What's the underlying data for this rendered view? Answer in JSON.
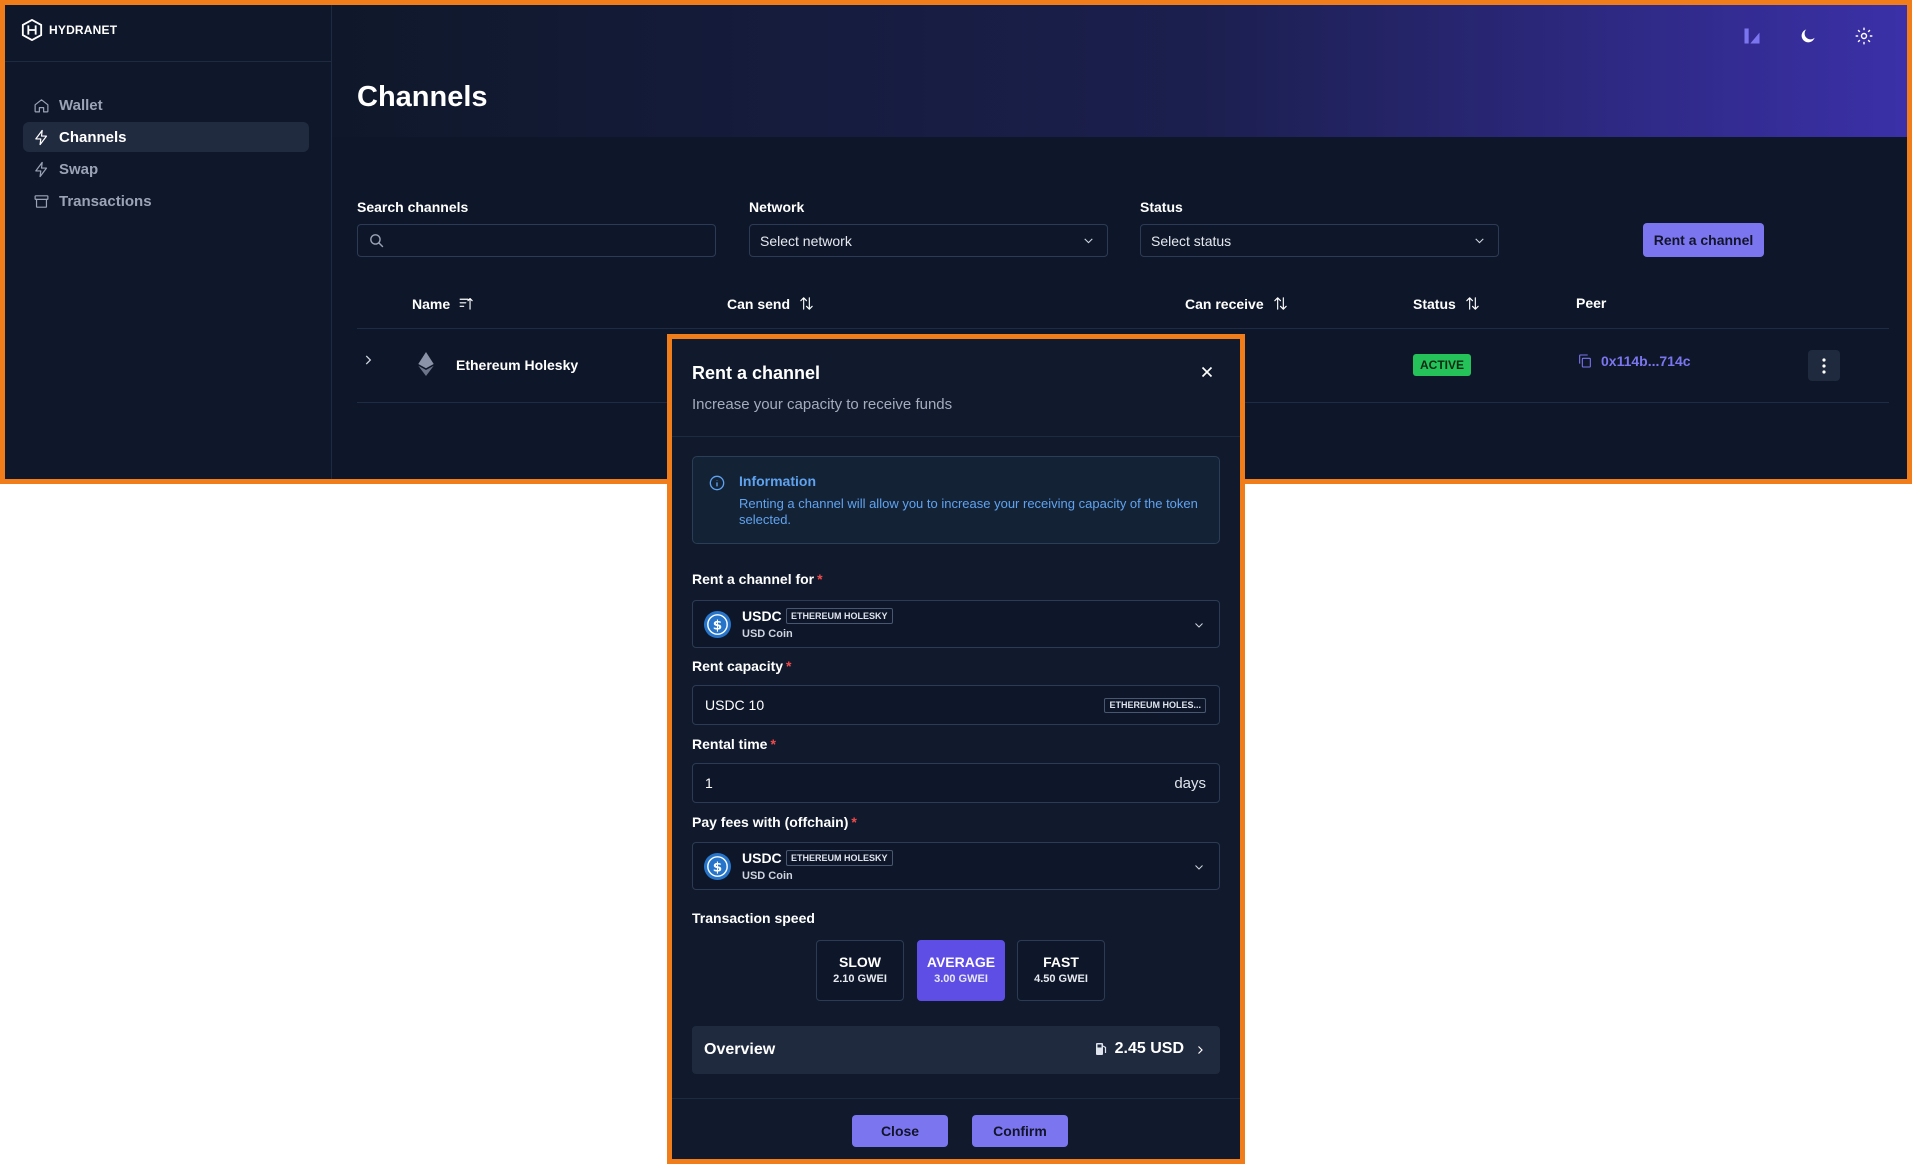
{
  "app": {
    "logo_text": "HYDRANET"
  },
  "sidebar": {
    "items": [
      {
        "label": "Wallet",
        "icon": "home-icon",
        "active": false
      },
      {
        "label": "Channels",
        "icon": "lightning-icon",
        "active": true
      },
      {
        "label": "Swap",
        "icon": "lightning-icon",
        "active": false
      },
      {
        "label": "Transactions",
        "icon": "archive-icon",
        "active": false
      }
    ]
  },
  "header": {
    "title": "Channels",
    "icons": [
      "chart-icon",
      "moon-icon",
      "gear-icon"
    ]
  },
  "filters": {
    "search": {
      "label": "Search channels",
      "placeholder": ""
    },
    "network": {
      "label": "Network",
      "value": "Select network"
    },
    "status": {
      "label": "Status",
      "value": "Select status"
    },
    "rent_button": "Rent a channel"
  },
  "table": {
    "columns": [
      "Name",
      "Can send",
      "Can receive",
      "Status",
      "Peer"
    ],
    "rows": [
      {
        "name": "Ethereum Holesky",
        "status": "ACTIVE",
        "peer": "0x114b...714c"
      }
    ]
  },
  "modal": {
    "title": "Rent a channel",
    "subtitle": "Increase your capacity to receive funds",
    "info": {
      "title": "Information",
      "text": "Renting a channel will allow you to increase your receiving capacity of the token selected."
    },
    "rent_for": {
      "label": "Rent a channel for",
      "required": "*",
      "symbol": "USDC",
      "network": "ETHEREUM HOLESKY",
      "name": "USD Coin"
    },
    "capacity": {
      "label": "Rent capacity",
      "required": "*",
      "value": "USDC 10",
      "network_badge": "ETHEREUM HOLES..."
    },
    "rental_time": {
      "label": "Rental time",
      "required": "*",
      "value": "1",
      "unit": "days"
    },
    "pay_fees": {
      "label": "Pay fees with (offchain)",
      "required": "*",
      "symbol": "USDC",
      "network": "ETHEREUM HOLESKY",
      "name": "USD Coin"
    },
    "speed": {
      "label": "Transaction speed",
      "options": [
        {
          "name": "SLOW",
          "gwei": "2.10 GWEI",
          "active": false
        },
        {
          "name": "AVERAGE",
          "gwei": "3.00 GWEI",
          "active": true
        },
        {
          "name": "FAST",
          "gwei": "4.50 GWEI",
          "active": false
        }
      ]
    },
    "overview": {
      "label": "Overview",
      "value": "2.45 USD"
    },
    "buttons": {
      "close": "Close",
      "confirm": "Confirm"
    }
  },
  "colors": {
    "accent": "#7b76f0",
    "active_speed": "#5f4ee6",
    "status_active": "#25c25a",
    "info_text": "#5fa3f0",
    "frame": "#f07d1a"
  }
}
